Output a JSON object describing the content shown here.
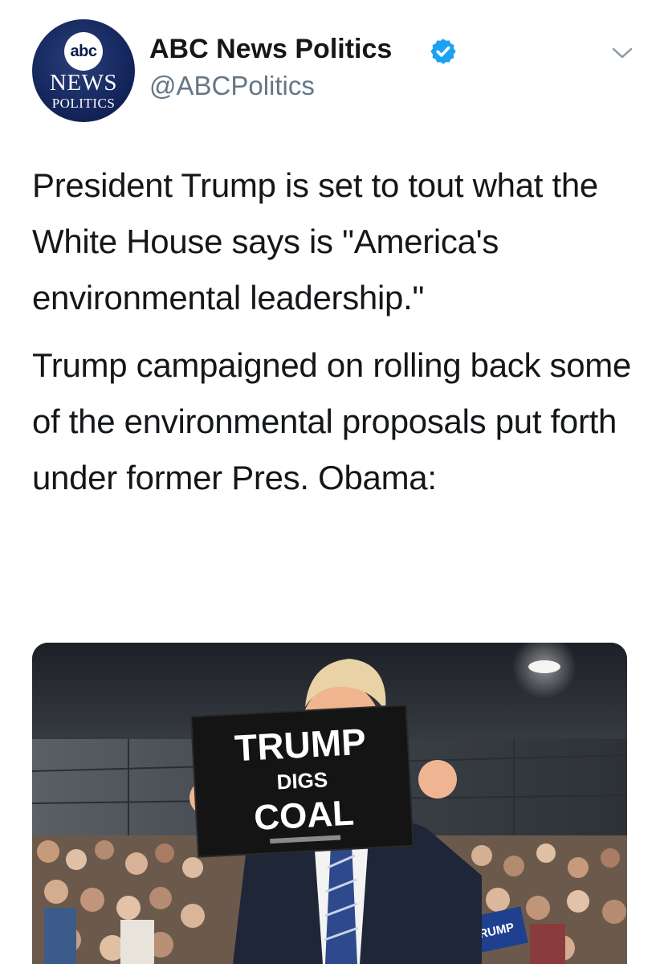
{
  "account": {
    "logo_abc": "abc",
    "logo_news": "NEWS",
    "logo_politics": "POLITICS",
    "display_name": "ABC News Politics",
    "handle": "@ABCPolitics",
    "verified": true
  },
  "icons": {
    "verified": "verified-badge-icon",
    "menu": "chevron-down-icon"
  },
  "colors": {
    "verified_blue": "#1da1f2",
    "handle_gray": "#657786",
    "text": "#14171a",
    "logo_navy": "#13245a"
  },
  "tweet": {
    "paragraph1": "President Trump is set to tout what the White House says is \"America's environmental leadership.\"",
    "paragraph2": "Trump campaigned on rolling back some of the environmental proposals put forth under former Pres. Obama:"
  },
  "media": {
    "sign_line1": "TRUMP",
    "sign_line2": "DIGS",
    "sign_line3": "COAL",
    "crowd_sign": "TRUMP"
  }
}
